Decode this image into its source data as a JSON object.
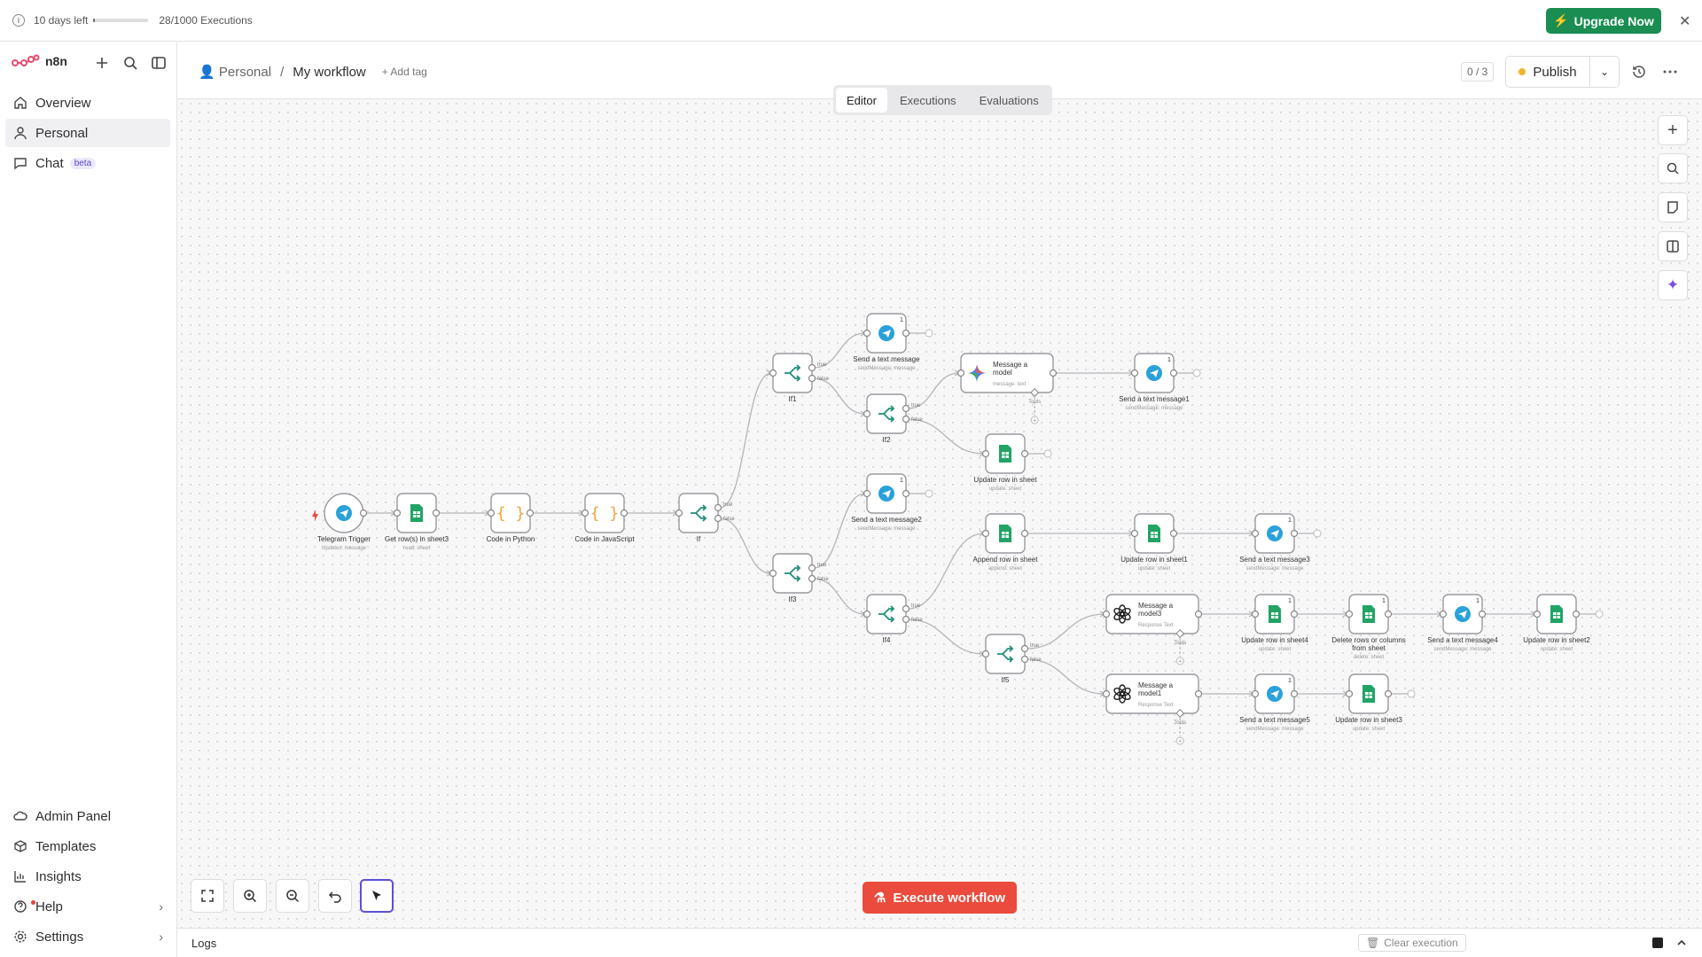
{
  "banner": {
    "trial": "10 days left",
    "executions": "28/1000 Executions",
    "execution_fraction": 0.028,
    "upgrade_label": "Upgrade Now"
  },
  "sidebar": {
    "brand": "n8n",
    "items": [
      {
        "label": "Overview",
        "icon": "home-icon"
      },
      {
        "label": "Personal",
        "icon": "user-icon"
      },
      {
        "label": "Chat",
        "icon": "chat-icon",
        "badge": "beta"
      }
    ],
    "bottom_items": [
      {
        "label": "Admin Panel",
        "icon": "cloud-icon"
      },
      {
        "label": "Templates",
        "icon": "box-icon"
      },
      {
        "label": "Insights",
        "icon": "chart-icon"
      },
      {
        "label": "Help",
        "icon": "help-icon"
      },
      {
        "label": "Settings",
        "icon": "gear-icon"
      }
    ]
  },
  "header": {
    "project": "Personal",
    "workflow": "My workflow",
    "add_tag": "+ Add tag",
    "publish_count": "0 / 3",
    "publish_label": "Publish"
  },
  "tabs": [
    "Editor",
    "Executions",
    "Evaluations"
  ],
  "execute_label": "Execute workflow",
  "logs_label": "Logs",
  "clear_label": "Clear execution",
  "colors": {
    "accent": "#ea4b3c",
    "upgrade": "#1a8d52",
    "sheets": "#21a464",
    "telegram": "#2aa1da",
    "code": "#f0a53c"
  },
  "nodes": [
    {
      "id": "tg",
      "label": "Telegram Trigger",
      "sub": "Updates: message",
      "icon": "telegram-icon"
    },
    {
      "id": "gr",
      "label": "Get row(s) in sheet3",
      "sub": "read: sheet",
      "icon": "sheets-icon"
    },
    {
      "id": "py",
      "label": "Code in Python",
      "sub": "",
      "icon": "code-icon"
    },
    {
      "id": "js",
      "label": "Code in JavaScript",
      "sub": "",
      "icon": "code-icon"
    },
    {
      "id": "if",
      "label": "If",
      "sub": "",
      "icon": "if-icon"
    },
    {
      "id": "if1",
      "label": "If1",
      "sub": "",
      "icon": "if-icon"
    },
    {
      "id": "if3",
      "label": "If3",
      "sub": "",
      "icon": "if-icon"
    },
    {
      "id": "stm",
      "label": "Send a text message",
      "sub": "sendMessage: message",
      "icon": "telegram-icon",
      "badge": "1"
    },
    {
      "id": "if2",
      "label": "If2",
      "sub": "",
      "icon": "if-icon"
    },
    {
      "id": "stm2",
      "label": "Send a text message2",
      "sub": "sendMessage: message",
      "icon": "telegram-icon",
      "badge": "1"
    },
    {
      "id": "if4",
      "label": "If4",
      "sub": "",
      "icon": "if-icon"
    },
    {
      "id": "mam",
      "label": "Message a model",
      "sub": "message: text",
      "icon": "gemini-icon",
      "tools": "Tools"
    },
    {
      "id": "urs",
      "label": "Update row in sheet",
      "sub": "update: sheet",
      "icon": "sheets-icon"
    },
    {
      "id": "ars",
      "label": "Append row in sheet",
      "sub": "append: sheet",
      "icon": "sheets-icon"
    },
    {
      "id": "if5",
      "label": "If5",
      "sub": "",
      "icon": "if-icon"
    },
    {
      "id": "stm1",
      "label": "Send a text message1",
      "sub": "sendMessage: message",
      "icon": "telegram-icon",
      "badge": "1"
    },
    {
      "id": "urs1",
      "label": "Update row in sheet1",
      "sub": "update: sheet",
      "icon": "sheets-icon"
    },
    {
      "id": "stm3",
      "label": "Send a text message3",
      "sub": "sendMessage: message",
      "icon": "telegram-icon",
      "badge": "1"
    },
    {
      "id": "mam3",
      "label": "Message a model3",
      "sub": "Response Text",
      "icon": "openai-icon",
      "tools": "Tools"
    },
    {
      "id": "mam1",
      "label": "Message a model1",
      "sub": "Response Text",
      "icon": "openai-icon",
      "tools": "Tools"
    },
    {
      "id": "urs4",
      "label": "Update row in sheet4",
      "sub": "update: sheet",
      "icon": "sheets-icon",
      "badge": "1"
    },
    {
      "id": "drc",
      "label": "Delete rows or columns from sheet",
      "sub": "delete: sheet",
      "icon": "sheets-icon",
      "badge": "1"
    },
    {
      "id": "stm4",
      "label": "Send a text message4",
      "sub": "sendMessage: message",
      "icon": "telegram-icon",
      "badge": "1"
    },
    {
      "id": "urs2",
      "label": "Update row in sheet2",
      "sub": "update: sheet",
      "icon": "sheets-icon"
    },
    {
      "id": "stm5",
      "label": "Send a text message5",
      "sub": "sendMessage: message",
      "icon": "telegram-icon",
      "badge": "1"
    },
    {
      "id": "urs3",
      "label": "Update row in sheet3",
      "sub": "update: sheet",
      "icon": "sheets-icon"
    }
  ],
  "branch_labels": {
    "true": "true",
    "false": "false"
  }
}
